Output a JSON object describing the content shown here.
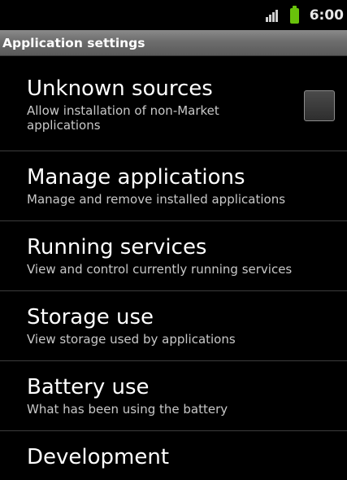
{
  "status_bar": {
    "time": "6:00",
    "signal_icon": "signal-bars-icon",
    "battery_icon": "battery-icon",
    "battery_color": "#69c20b"
  },
  "title_bar": {
    "title": "Application settings"
  },
  "items": [
    {
      "title": "Unknown sources",
      "summary": "Allow installation of non-Market applications",
      "checked": false
    },
    {
      "title": "Manage applications",
      "summary": "Manage and remove installed applications"
    },
    {
      "title": "Running services",
      "summary": "View and control currently running services"
    },
    {
      "title": "Storage use",
      "summary": "View storage used by applications"
    },
    {
      "title": "Battery use",
      "summary": "What has been using the battery"
    },
    {
      "title": "Development",
      "summary": ""
    }
  ]
}
